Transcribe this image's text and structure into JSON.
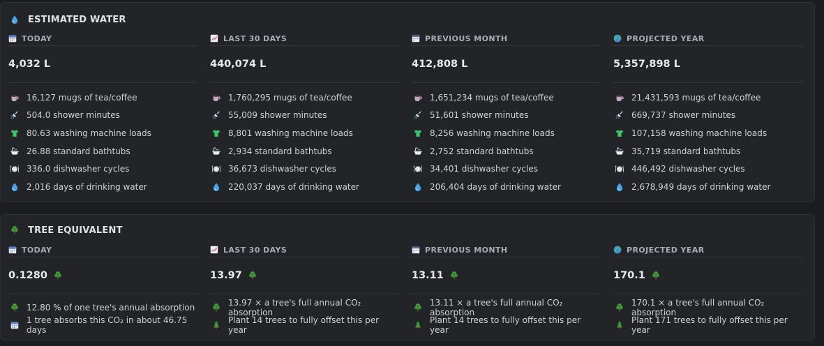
{
  "water": {
    "title": "ESTIMATED WATER",
    "columns": [
      {
        "head": "TODAY",
        "icon": "calendar-icon",
        "value": "4,032 L",
        "items": [
          "16,127 mugs of tea/coffee",
          "504.0 shower minutes",
          "80.63 washing machine loads",
          "26.88 standard bathtubs",
          "336.0 dishwasher cycles",
          "2,016 days of drinking water"
        ]
      },
      {
        "head": "LAST 30 DAYS",
        "icon": "chart-icon",
        "value": "440,074 L",
        "items": [
          "1,760,295 mugs of tea/coffee",
          "55,009 shower minutes",
          "8,801 washing machine loads",
          "2,934 standard bathtubs",
          "36,673 dishwasher cycles",
          "220,037 days of drinking water"
        ]
      },
      {
        "head": "PREVIOUS MONTH",
        "icon": "calendar-spiral-icon",
        "value": "412,808 L",
        "items": [
          "1,651,234 mugs of tea/coffee",
          "51,601 shower minutes",
          "8,256 washing machine loads",
          "2,752 standard bathtubs",
          "34,401 dishwasher cycles",
          "206,404 days of drinking water"
        ]
      },
      {
        "head": "PROJECTED YEAR",
        "icon": "globe-icon",
        "value": "5,357,898 L",
        "items": [
          "21,431,593 mugs of tea/coffee",
          "669,737 shower minutes",
          "107,158 washing machine loads",
          "35,719 standard bathtubs",
          "446,492 dishwasher cycles",
          "2,678,949 days of drinking water"
        ]
      }
    ],
    "item_icons": [
      "mug-icon",
      "shower-icon",
      "shirt-icon",
      "bathtub-icon",
      "plate-icon",
      "droplet-icon"
    ]
  },
  "trees": {
    "title": "TREE EQUIVALENT",
    "columns": [
      {
        "head": "TODAY",
        "icon": "calendar-icon",
        "value": "0.1280",
        "items": [
          "12.80 % of one tree's annual absorption",
          "1 tree absorbs this CO₂ in about 46.75 days"
        ],
        "item_icons": [
          "tree-icon",
          "calendar-icon"
        ]
      },
      {
        "head": "LAST 30 DAYS",
        "icon": "chart-icon",
        "value": "13.97",
        "items": [
          "13.97 × a tree's full annual CO₂ absorption",
          "Plant 14 trees to fully offset this per year"
        ],
        "item_icons": [
          "tree-icon",
          "pine-icon"
        ]
      },
      {
        "head": "PREVIOUS MONTH",
        "icon": "calendar-spiral-icon",
        "value": "13.11",
        "items": [
          "13.11 × a tree's full annual CO₂ absorption",
          "Plant 14 trees to fully offset this per year"
        ],
        "item_icons": [
          "tree-icon",
          "pine-icon"
        ]
      },
      {
        "head": "PROJECTED YEAR",
        "icon": "globe-icon",
        "value": "170.1",
        "items": [
          "170.1 × a tree's full annual CO₂ absorption",
          "Plant 171 trees to fully offset this per year"
        ],
        "item_icons": [
          "tree-icon",
          "pine-icon"
        ]
      }
    ]
  },
  "colors": {
    "panel": "#232427",
    "background": "#1c1d20",
    "tree_green": "#3f9a3a",
    "water_blue": "#4aa3e8"
  }
}
